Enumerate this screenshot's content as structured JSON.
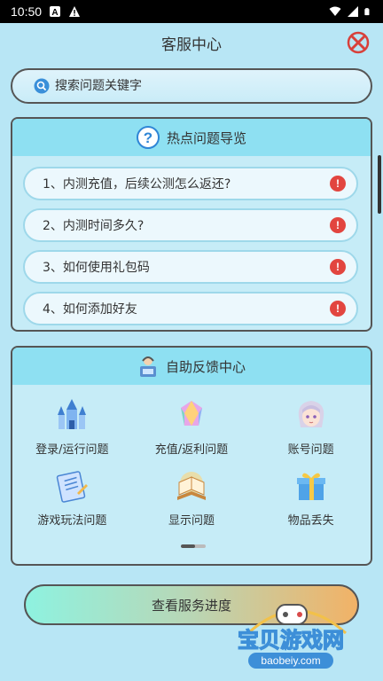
{
  "status_bar": {
    "time": "10:50"
  },
  "header": {
    "title": "客服中心"
  },
  "search": {
    "placeholder": "搜索问题关键字"
  },
  "hot_panel": {
    "title": "热点问题导览",
    "items": [
      {
        "label": "1、内测充值，后续公测怎么返还?"
      },
      {
        "label": "2、内测时间多久?"
      },
      {
        "label": "3、如何使用礼包码"
      },
      {
        "label": "4、如何添加好友"
      }
    ]
  },
  "self_panel": {
    "title": "自助反馈中心",
    "items": [
      {
        "label": "登录/运行问题",
        "icon": "castle-icon"
      },
      {
        "label": "充值/返利问题",
        "icon": "gem-icon"
      },
      {
        "label": "账号问题",
        "icon": "character-avatar-icon"
      },
      {
        "label": "游戏玩法问题",
        "icon": "notebook-icon"
      },
      {
        "label": "显示问题",
        "icon": "book-icon"
      },
      {
        "label": "物品丢失",
        "icon": "gift-icon"
      }
    ],
    "page": 1,
    "pages": 2
  },
  "progress_button": {
    "label": "查看服务进度"
  },
  "watermark": {
    "cn": "宝贝游戏网",
    "url": "baobeiy.com"
  },
  "colors": {
    "background": "#b8e6f5",
    "panel_header": "#8ee0f2",
    "alert": "#e2453f"
  }
}
